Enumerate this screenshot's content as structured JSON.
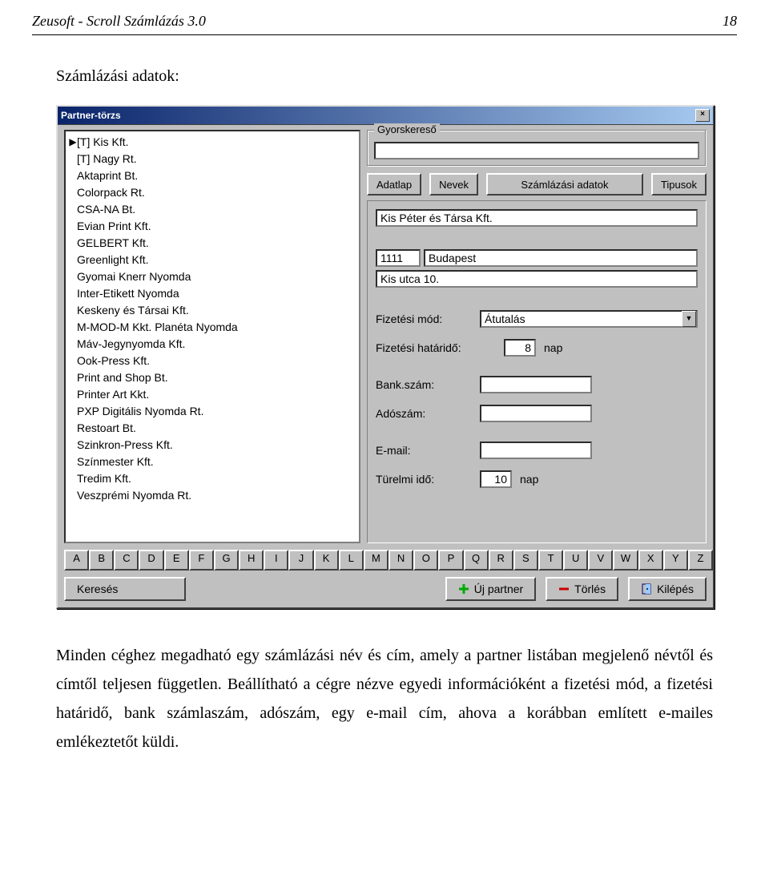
{
  "doc": {
    "header_left": "Zeusoft - Scroll Számlázás 3.0",
    "page_number": "18",
    "section_title": "Számlázási adatok:",
    "body_paragraph": "Minden céghez megadható egy számlázási név és cím, amely a partner listában megjelenő névtől és címtől teljesen független. Beállítható a cégre nézve egyedi információként a fizetési mód, a fizetési határidő, bank számlaszám, adószám, egy e-mail cím, ahova a korábban említett e-mailes emlékeztetőt küldi."
  },
  "window": {
    "title": "Partner-törzs",
    "close": "×",
    "list_items": [
      "[T] Kis Kft.",
      "[T] Nagy Rt.",
      "Aktaprint Bt.",
      "Colorpack Rt.",
      "CSA-NA Bt.",
      "Evian Print Kft.",
      "GELBERT Kft.",
      "Greenlight Kft.",
      "Gyomai Knerr Nyomda",
      "Inter-Etikett Nyomda",
      "Keskeny és Társai Kft.",
      "M-MOD-M Kkt. Planéta Nyomda",
      "Máv-Jegynyomda Kft.",
      "Ook-Press Kft.",
      "Print and Shop Bt.",
      "Printer Art Kkt.",
      "PXP Digitális Nyomda Rt.",
      "Restoart Bt.",
      "Szinkron-Press Kft.",
      "Színmester Kft.",
      "Tredim Kft.",
      "Veszprémi Nyomda Rt."
    ],
    "quicksearch_label": "Gyorskereső",
    "quicksearch_value": "",
    "tabs": {
      "adatlap": "Adatlap",
      "nevek": "Nevek",
      "szamlazasi": "Számlázási adatok",
      "tipusok": "Tipusok"
    },
    "form": {
      "company": "Kis Péter és Társa Kft.",
      "zip": "1111",
      "city": "Budapest",
      "street": "Kis utca 10.",
      "pay_method_label": "Fizetési mód:",
      "pay_method_value": "Átutalás",
      "pay_term_label": "Fizetési határidő:",
      "pay_term_value": "8",
      "pay_term_unit": "nap",
      "bank_label": "Bank.szám:",
      "bank_value": "",
      "tax_label": "Adószám:",
      "tax_value": "",
      "email_label": "E-mail:",
      "email_value": "",
      "grace_label": "Türelmi idő:",
      "grace_value": "10",
      "grace_unit": "nap"
    },
    "alphabet": [
      "A",
      "B",
      "C",
      "D",
      "E",
      "F",
      "G",
      "H",
      "I",
      "J",
      "K",
      "L",
      "M",
      "N",
      "O",
      "P",
      "Q",
      "R",
      "S",
      "T",
      "U",
      "V",
      "W",
      "X",
      "Y",
      "Z"
    ],
    "buttons": {
      "search": "Keresés",
      "new": "Új partner",
      "delete": "Törlés",
      "exit": "Kilépés"
    }
  }
}
